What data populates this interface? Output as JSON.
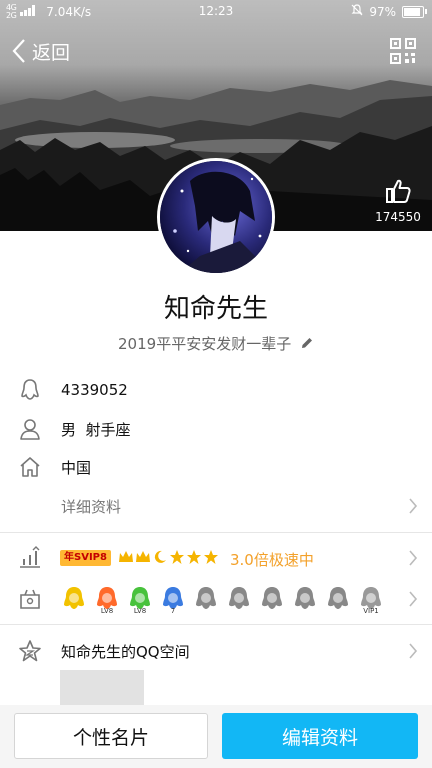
{
  "status_bar": {
    "signal_top": "4G",
    "signal_bottom": "2G",
    "net_speed": "7.04K/s",
    "time": "12:23",
    "battery_percent": "97%",
    "battery_level": 0.97
  },
  "header": {
    "back_label": "返回",
    "like_count": "174550"
  },
  "profile": {
    "nickname": "知命先生",
    "signature": "2019平平安安发财一辈子",
    "qq_number": "4339052",
    "gender_sign": "男  射手座",
    "location": "中国",
    "detail_link": "详细资料"
  },
  "vip": {
    "badge": "年SVIP8",
    "speed_text": "3.0倍极速中"
  },
  "qzone": {
    "title": "知命先生的QQ空间"
  },
  "bottom": {
    "card_button": "个性名片",
    "edit_button": "编辑资料"
  },
  "colors": {
    "accent": "#12b7f5",
    "vip_gold": "#f3a12b"
  },
  "medals": [
    {
      "name": "qq-penguin-icon",
      "color": "#f2c200",
      "label": ""
    },
    {
      "name": "lightning-icon",
      "color": "#ff6a2b",
      "label": "LV8"
    },
    {
      "name": "game-diamond-icon",
      "color": "#48c23c",
      "label": "LV8"
    },
    {
      "name": "star-icon",
      "color": "#3b7be0",
      "label": "7"
    },
    {
      "name": "gray-mountain-icon",
      "color": "#888888",
      "label": ""
    },
    {
      "name": "gray-penguin-icon",
      "color": "#888888",
      "label": ""
    },
    {
      "name": "gray-penguin-icon-2",
      "color": "#888888",
      "label": ""
    },
    {
      "name": "gray-penguin-icon-3",
      "color": "#888888",
      "label": ""
    },
    {
      "name": "gray-penguin-icon-4",
      "color": "#888888",
      "label": ""
    },
    {
      "name": "vip-v-icon",
      "color": "#999999",
      "label": "VIP1"
    }
  ]
}
